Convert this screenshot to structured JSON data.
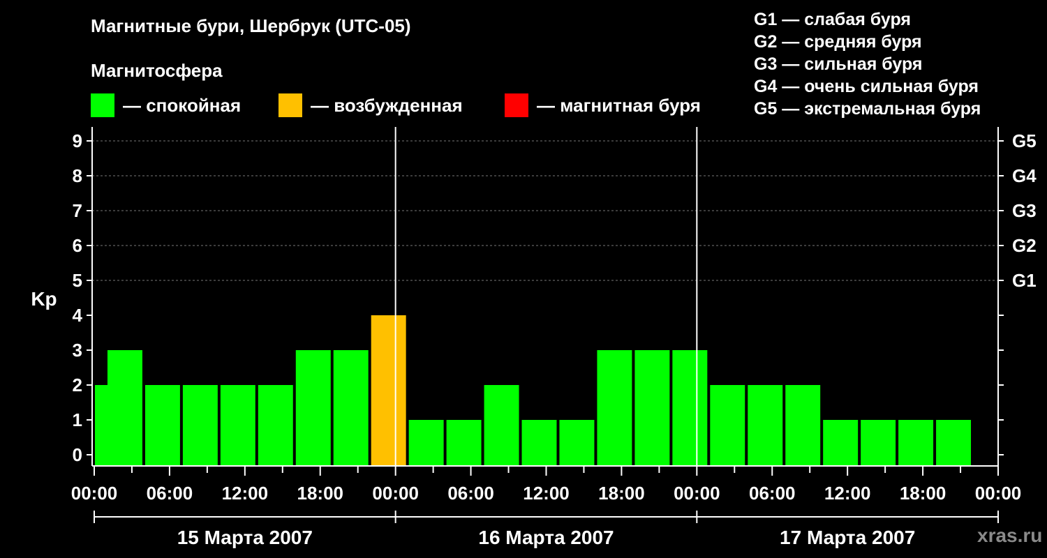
{
  "title": "Магнитные бури, Шербрук (UTC-05)",
  "legend": {
    "heading": "Магнитосфера",
    "items": [
      {
        "color": "#00ff00",
        "label": "— спокойная"
      },
      {
        "color": "#ffc000",
        "label": "— возбужденная"
      },
      {
        "color": "#ff0000",
        "label": "— магнитная буря"
      }
    ]
  },
  "g_scale": [
    "G1 — слабая буря",
    "G2 — средняя буря",
    "G3 — сильная буря",
    "G4 — очень сильная буря",
    "G5 — экстремальная буря"
  ],
  "watermark": "xras.ru",
  "chart_data": {
    "type": "bar",
    "ylabel": "Kp",
    "ylim": [
      0,
      9
    ],
    "yticks": [
      0,
      1,
      2,
      3,
      4,
      5,
      6,
      7,
      8,
      9
    ],
    "right_axis_labels": [
      {
        "kp": 5,
        "label": "G1"
      },
      {
        "kp": 6,
        "label": "G2"
      },
      {
        "kp": 7,
        "label": "G3"
      },
      {
        "kp": 8,
        "label": "G4"
      },
      {
        "kp": 9,
        "label": "G5"
      }
    ],
    "x_range_hours": [
      0,
      72
    ],
    "x_tick_labels": [
      "00:00",
      "06:00",
      "12:00",
      "18:00",
      "00:00",
      "06:00",
      "12:00",
      "18:00",
      "00:00",
      "06:00",
      "12:00",
      "18:00",
      "00:00"
    ],
    "days": [
      "15 Марта 2007",
      "16 Марта 2007",
      "17 Марта 2007"
    ],
    "bar_width_hours": 3,
    "bars": [
      {
        "start_hour": 0,
        "kp": 2,
        "color": "#00ff00"
      },
      {
        "start_hour": 1,
        "kp": 3,
        "color": "#00ff00"
      },
      {
        "start_hour": 4,
        "kp": 2,
        "color": "#00ff00"
      },
      {
        "start_hour": 7,
        "kp": 2,
        "color": "#00ff00"
      },
      {
        "start_hour": 10,
        "kp": 2,
        "color": "#00ff00"
      },
      {
        "start_hour": 13,
        "kp": 2,
        "color": "#00ff00"
      },
      {
        "start_hour": 16,
        "kp": 3,
        "color": "#00ff00"
      },
      {
        "start_hour": 19,
        "kp": 3,
        "color": "#00ff00"
      },
      {
        "start_hour": 22,
        "kp": 4,
        "color": "#ffc000"
      },
      {
        "start_hour": 25,
        "kp": 1,
        "color": "#00ff00"
      },
      {
        "start_hour": 28,
        "kp": 1,
        "color": "#00ff00"
      },
      {
        "start_hour": 31,
        "kp": 2,
        "color": "#00ff00"
      },
      {
        "start_hour": 34,
        "kp": 1,
        "color": "#00ff00"
      },
      {
        "start_hour": 37,
        "kp": 1,
        "color": "#00ff00"
      },
      {
        "start_hour": 40,
        "kp": 3,
        "color": "#00ff00"
      },
      {
        "start_hour": 43,
        "kp": 3,
        "color": "#00ff00"
      },
      {
        "start_hour": 46,
        "kp": 3,
        "color": "#00ff00"
      },
      {
        "start_hour": 49,
        "kp": 2,
        "color": "#00ff00"
      },
      {
        "start_hour": 52,
        "kp": 2,
        "color": "#00ff00"
      },
      {
        "start_hour": 55,
        "kp": 2,
        "color": "#00ff00"
      },
      {
        "start_hour": 58,
        "kp": 1,
        "color": "#00ff00"
      },
      {
        "start_hour": 61,
        "kp": 1,
        "color": "#00ff00"
      },
      {
        "start_hour": 64,
        "kp": 1,
        "color": "#00ff00"
      },
      {
        "start_hour": 67,
        "kp": 1,
        "color": "#00ff00"
      }
    ]
  }
}
